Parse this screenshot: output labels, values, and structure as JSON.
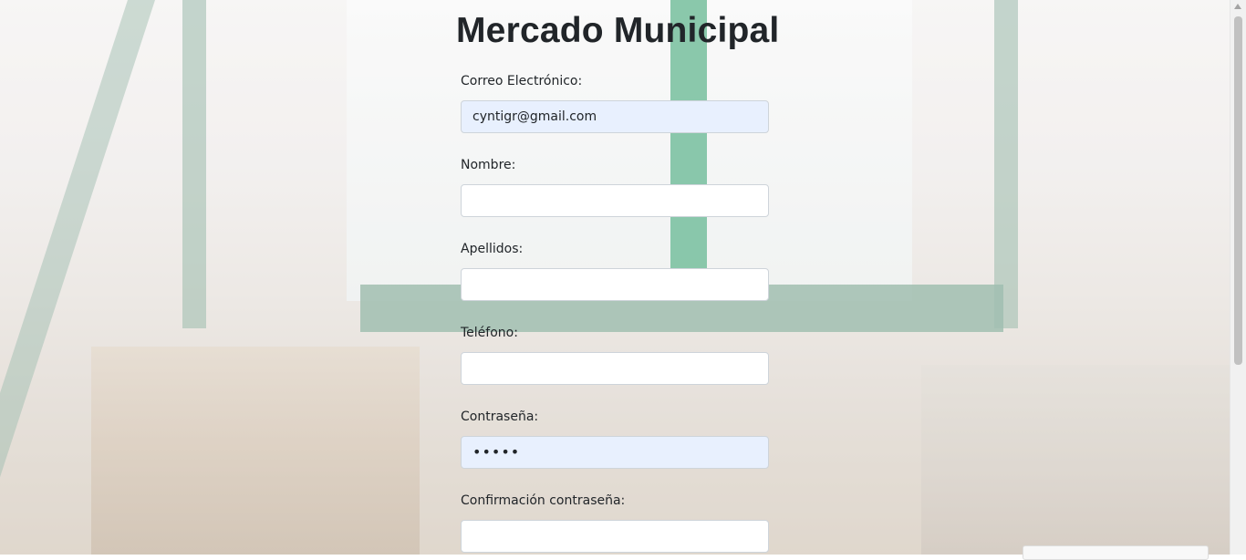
{
  "page": {
    "title": "Mercado Municipal"
  },
  "form": {
    "fields": [
      {
        "label": "Correo Electrónico:",
        "value": "cyntigr@gmail.com",
        "type": "email",
        "autofilled": true
      },
      {
        "label": "Nombre:",
        "value": "",
        "type": "text",
        "autofilled": false
      },
      {
        "label": "Apellidos:",
        "value": "",
        "type": "text",
        "autofilled": false
      },
      {
        "label": "Teléfono:",
        "value": "",
        "type": "tel",
        "autofilled": false
      },
      {
        "label": "Contraseña:",
        "value": "•••••",
        "type": "password",
        "autofilled": true
      },
      {
        "label": "Confirmación contraseña:",
        "value": "",
        "type": "password",
        "autofilled": false
      }
    ]
  },
  "colors": {
    "autofill_background": "#e8f0fe",
    "input_border": "#ced4da",
    "text": "#212529"
  }
}
